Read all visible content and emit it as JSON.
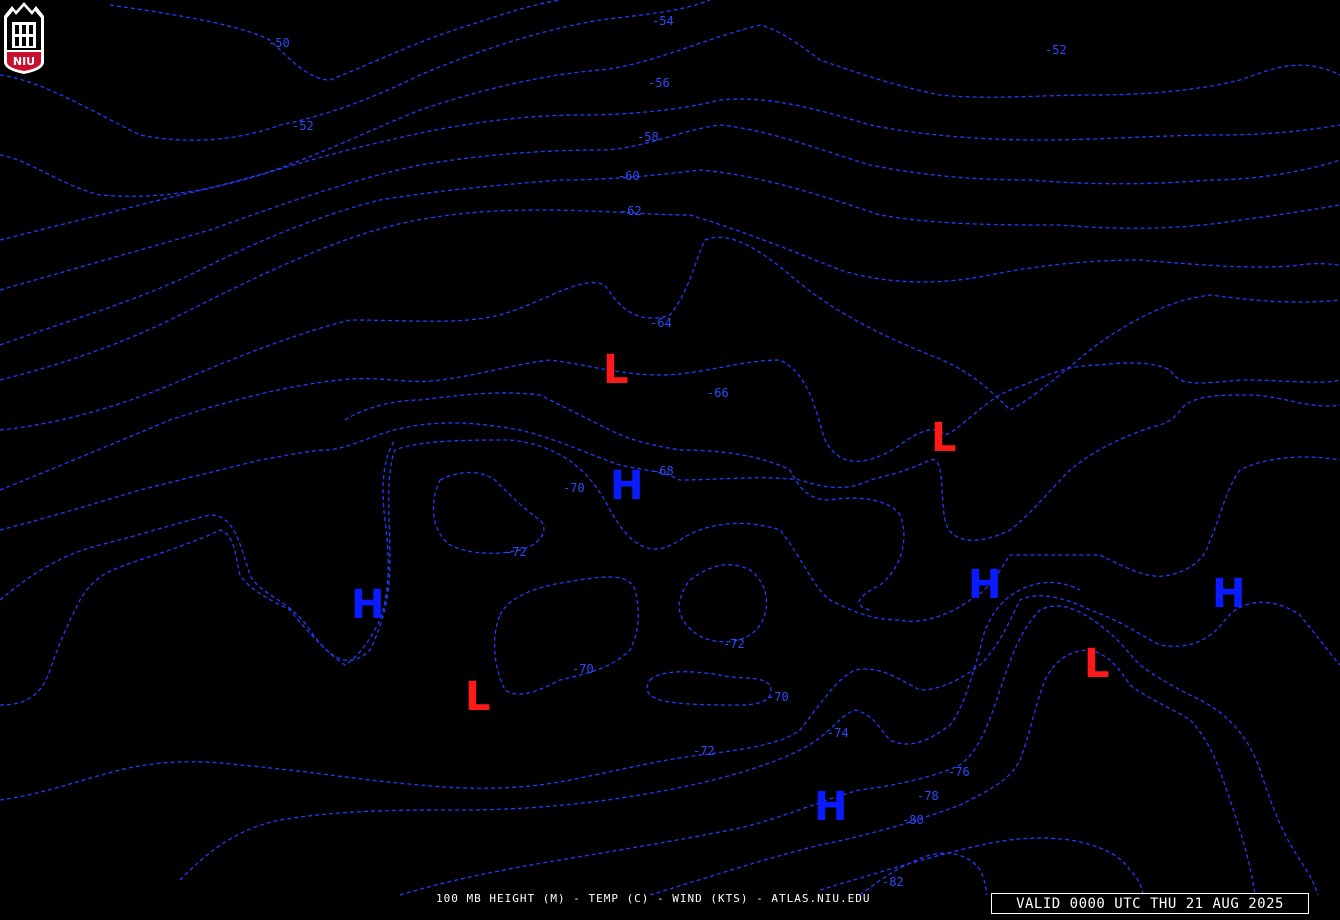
{
  "footer": {
    "title": "100 MB HEIGHT (M) - TEMP (C) - WIND (KTS) - ATLAS.NIU.EDU",
    "valid": "VALID 0000 UTC THU 21 AUG 2025"
  },
  "logo": {
    "text": "NIU",
    "icon": "niu-tower-logo"
  },
  "colors": {
    "background": "#000000",
    "contour": "#1f3cff",
    "high": "#0a1cff",
    "low": "#ff1a1a",
    "text": "#ffffff"
  },
  "contour_labels": [
    {
      "text": "-50"
    },
    {
      "text": "-52"
    },
    {
      "text": "-54"
    },
    {
      "text": "-56"
    },
    {
      "text": "-58"
    },
    {
      "text": "-60"
    },
    {
      "text": "-62"
    },
    {
      "text": "-52"
    },
    {
      "text": "-64"
    },
    {
      "text": "-66"
    },
    {
      "text": "-68"
    },
    {
      "text": "-70"
    },
    {
      "text": "-72"
    },
    {
      "text": "-72"
    },
    {
      "text": "-70"
    },
    {
      "text": "-70"
    },
    {
      "text": "-72"
    },
    {
      "text": "-74"
    },
    {
      "text": "-76"
    },
    {
      "text": "-78"
    },
    {
      "text": "-80"
    },
    {
      "text": "-82"
    }
  ],
  "pressure_centers": [
    {
      "type": "L",
      "text": "L"
    },
    {
      "type": "L",
      "text": "L"
    },
    {
      "type": "H",
      "text": "H"
    },
    {
      "type": "H",
      "text": "H"
    },
    {
      "type": "H",
      "text": "H"
    },
    {
      "type": "L",
      "text": "L"
    },
    {
      "type": "L",
      "text": "L"
    },
    {
      "type": "H",
      "text": "H"
    },
    {
      "type": "H",
      "text": "H"
    }
  ]
}
